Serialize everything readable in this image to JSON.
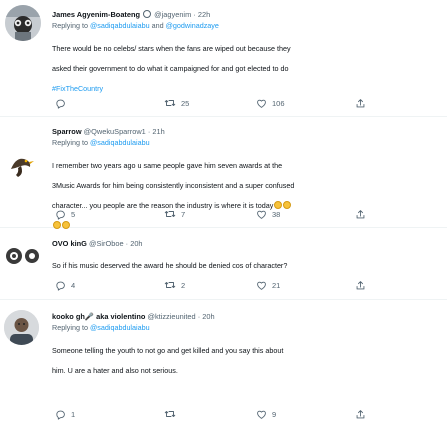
{
  "tweets": [
    {
      "name": "James Agyenim-Boateng",
      "handle": "@jagyenim",
      "sep": "·",
      "time": "22h",
      "reply_prefix": "Replying to ",
      "reply_user1": "@sadiqabdulaiabu",
      "reply_and": " and ",
      "reply_user2": "@godwinadzaye",
      "text_lines": [
        "There would be no celebs/ stars when the fans are wiped out because they",
        "asked their government to do what it campaigned for and got elected to do"
      ],
      "hashtag": "#FixTheCountry",
      "retweets": "25",
      "likes": "106",
      "replies": ""
    },
    {
      "name": "Sparrow",
      "handle": "@QwekuSparrow1",
      "sep": "·",
      "time": "21h",
      "reply_prefix": "Replying to ",
      "reply_user1": "@sadiqabdulaiabu",
      "text_lines": [
        "I remember two years ago u same people gave him seven awards at the",
        "3Music Awards for him being consistently inconsistent and a super confused",
        "character... you people are the reason the industry is where it is today"
      ],
      "replies": "5",
      "retweets": "7",
      "likes": "38"
    },
    {
      "name": "OVO kinG",
      "handle": "@SirOboe",
      "sep": "·",
      "time": "20h",
      "text_lines": [
        "So if his music deserved the award he should be denied cos of character?"
      ],
      "replies": "4",
      "retweets": "2",
      "likes": "21"
    },
    {
      "name": "kooko gh🎤 aka violentino",
      "handle": "@ktizzieunited",
      "sep": "·",
      "time": "20h",
      "reply_prefix": "Replying to ",
      "reply_user1": "@sadiqabdulaiabu",
      "text_lines": [
        "Someone telling the youth to not go and get killed and you say this about",
        "him. U are a hater and also not serious."
      ],
      "replies": "1",
      "retweets": "",
      "likes": "9"
    }
  ],
  "colors": {
    "text": "#0f1419",
    "muted": "#536471",
    "link": "#1d9bf0",
    "divider": "#eff3f4"
  },
  "icons": [
    "reply-icon",
    "retweet-icon",
    "like-icon",
    "share-icon"
  ]
}
